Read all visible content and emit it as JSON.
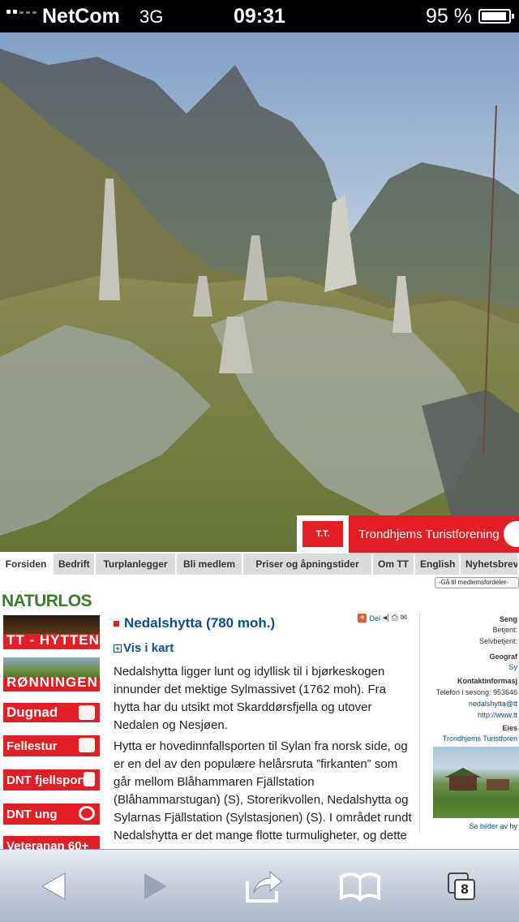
{
  "status_bar": {
    "carrier": "NetCom",
    "network": "3G",
    "time": "09:31",
    "battery": "95 %",
    "battery_level": 0.95
  },
  "banner": {
    "logo_text": "T.T.",
    "org_name": "Trondhjems Turistforening"
  },
  "nav": {
    "tabs": [
      {
        "label": "Forsiden",
        "active": true
      },
      {
        "label": "Bedrift"
      },
      {
        "label": "Turplanlegger"
      },
      {
        "label": "Bli medlem"
      },
      {
        "label": "Priser og åpningstider"
      },
      {
        "label": "Om TT"
      },
      {
        "label": "English"
      },
      {
        "label": "Nyhetsbrev"
      }
    ],
    "member_select": "-Gå til medlemsfordeler-"
  },
  "sidebar": {
    "naturlos": "NATURLOS",
    "banners": [
      {
        "label": "TT - HYTTENE"
      },
      {
        "label": "RØNNINGEN"
      },
      {
        "label": "Dugnad"
      },
      {
        "label": "Fellestur"
      },
      {
        "label": "DNT fjellsport"
      },
      {
        "label": "DNT ung"
      },
      {
        "label": "Veteranan 60+"
      }
    ]
  },
  "article": {
    "title": "Nedalshytta (780 moh.)",
    "share_label": "Del",
    "map_link": "Vis i kart",
    "paragraphs": [
      "Nedalshytta ligger lunt og idyllisk til i bjørkeskogen innunder det mektige Sylmassivet (1762 moh). Fra hytta har du utsikt mot Skarddørsfjella og utover Nedalen og Nesjøen.",
      "Hytta er hovedinnfallsporten til Sylan fra norsk side, og er en del av den populære helårsruta ”firkanten” som går mellom Blåhammaren Fjällstation (Blåhammarstugan) (S), Storerikvollen, Nedalshytta og Sylarnas Fjällstation (Sylstasjonen) (S). I området rundt Nedalshytta er det mange flotte turmuligheter, og dette"
    ]
  },
  "info": {
    "seng": "Seng",
    "betjent": "Betjent:",
    "selvbetjent": "Selvbetjent:",
    "geografi": "Geograf",
    "geografi_value": "Sy",
    "contact_heading": "Kontaktinformasj",
    "phone": "Telefon i sesong: 953646",
    "email": "nedalshytta@tt",
    "web": "http://www.tt",
    "owner_heading": "Eies",
    "owner": "Trondhjems Turistforen",
    "more_pictures": "Se bilder av hy"
  },
  "toolbar": {
    "tabs_count": "8"
  }
}
